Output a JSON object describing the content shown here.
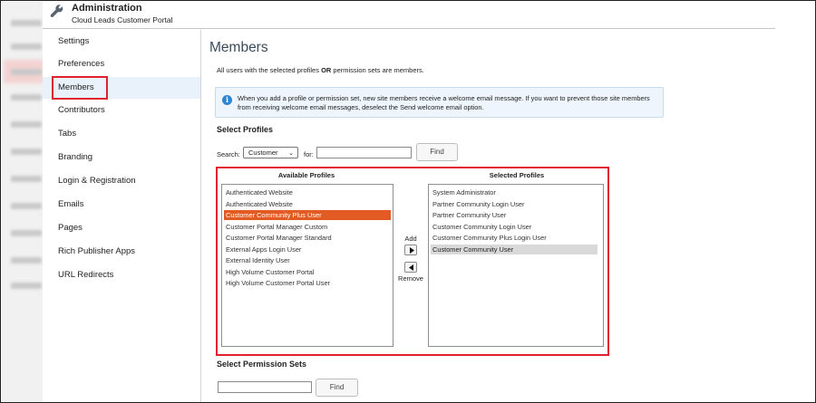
{
  "header": {
    "title": "Administration",
    "subtitle": "Cloud Leads Customer Portal"
  },
  "sidebar": {
    "items": [
      {
        "label": "Settings"
      },
      {
        "label": "Preferences"
      },
      {
        "label": "Members",
        "active": true
      },
      {
        "label": "Contributors"
      },
      {
        "label": "Tabs"
      },
      {
        "label": "Branding"
      },
      {
        "label": "Login & Registration"
      },
      {
        "label": "Emails"
      },
      {
        "label": "Pages"
      },
      {
        "label": "Rich Publisher Apps"
      },
      {
        "label": "URL Redirects"
      }
    ]
  },
  "main": {
    "title": "Members",
    "intro_before": "All users with the selected profiles ",
    "intro_bold": "OR",
    "intro_after": " permission sets are members.",
    "info_text": "When you add a profile or permission set, new site members receive a welcome email message. If you want to prevent those site members from receiving welcome email messages, deselect the Send welcome email option.",
    "select_profiles_heading": "Select Profiles",
    "search_label": "Search:",
    "search_select_value": "Customer",
    "for_label": "for:",
    "for_input_value": "",
    "find_label": "Find",
    "available_heading": "Available Profiles",
    "available_profiles": [
      "Authenticated Website",
      "Authenticated Website",
      "Customer Community Plus User",
      "Customer Portal Manager Custom",
      "Customer Portal Manager Standard",
      "External Apps Login User",
      "External Identity User",
      "High Volume Customer Portal",
      "High Volume Customer Portal User"
    ],
    "available_selected": "Customer Community Plus User",
    "add_label": "Add",
    "remove_label": "Remove",
    "selected_heading": "Selected Profiles",
    "selected_profiles": [
      "System Administrator",
      "Partner Community Login User",
      "Partner Community User",
      "Customer Community Login User",
      "Customer Community Plus Login User",
      "Customer Community User"
    ],
    "selected_highlighted": "Customer Community User",
    "permission_sets_heading": "Select Permission Sets",
    "perm_input_value": "",
    "perm_find_label": "Find"
  },
  "colors": {
    "highlight_box": "#e0202c",
    "selected_option": "#e25b22",
    "title": "#3c4b5c",
    "info_icon": "#2f86d0"
  },
  "icons": {
    "header": "wrench-icon",
    "info": "info-icon",
    "add_arrow": "arrow-right-icon",
    "remove_arrow": "arrow-left-icon"
  }
}
